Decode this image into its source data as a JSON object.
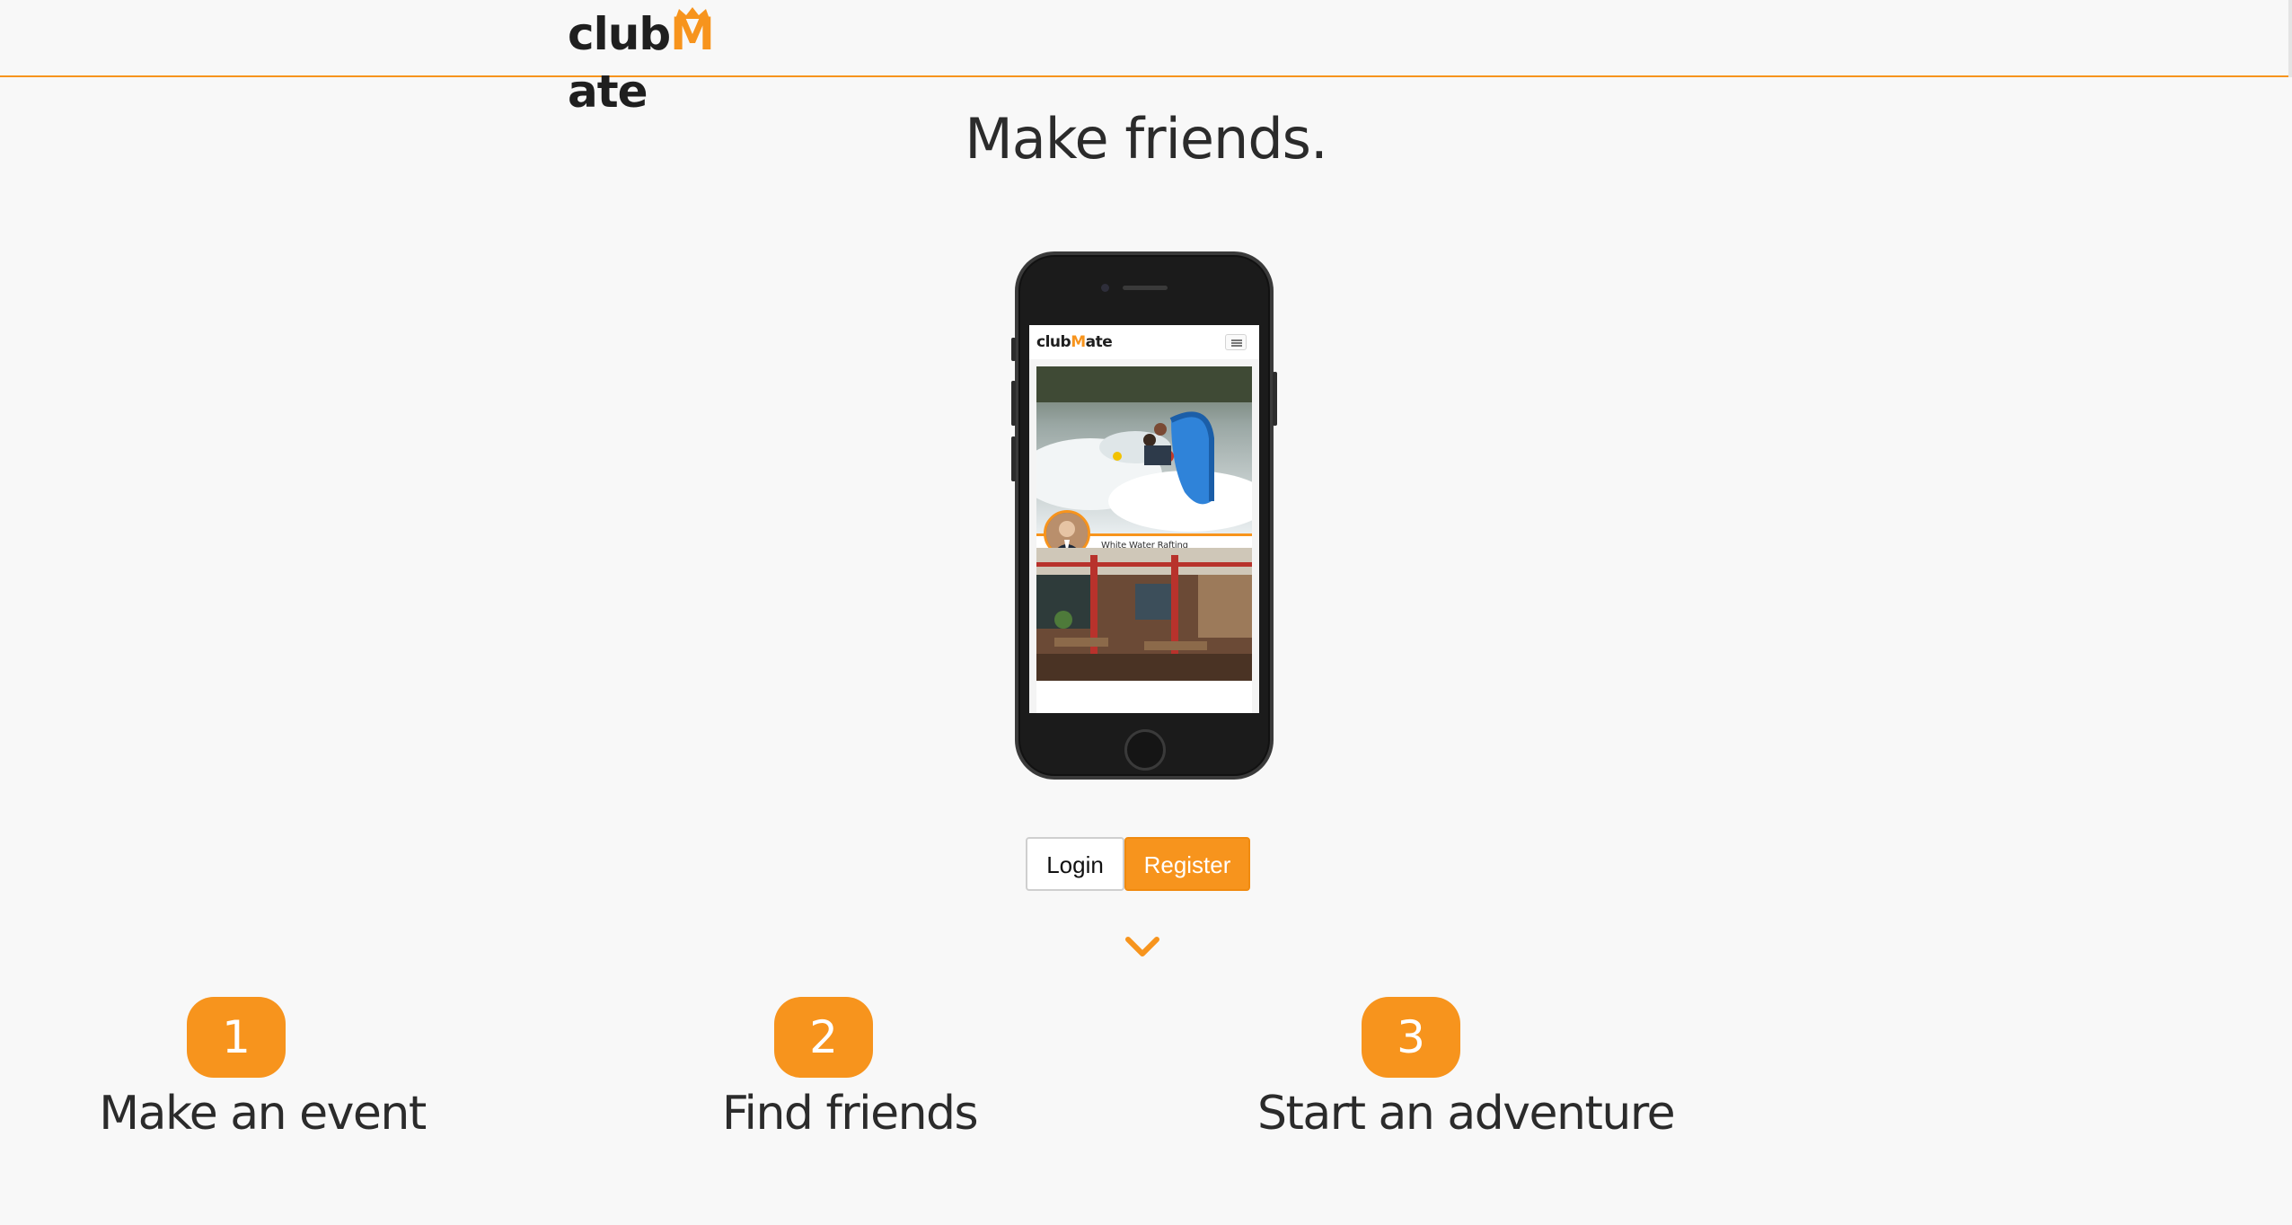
{
  "brand": {
    "logo_prefix": "club",
    "logo_m": "M",
    "logo_suffix": "ate",
    "accent_color": "#f7941d"
  },
  "hero": {
    "title": "Make friends."
  },
  "phone_preview": {
    "mini_logo_prefix": "club",
    "mini_logo_m": "M",
    "mini_logo_suffix": "ate",
    "cards": [
      {
        "caption": "White Water Rafting"
      }
    ]
  },
  "auth": {
    "login_label": "Login",
    "register_label": "Register"
  },
  "scroll_indicator": {
    "icon": "chevron-down-icon"
  },
  "steps": [
    {
      "number": "1",
      "label": "Make an event"
    },
    {
      "number": "2",
      "label": "Find friends"
    },
    {
      "number": "3",
      "label": "Start an adventure"
    }
  ]
}
